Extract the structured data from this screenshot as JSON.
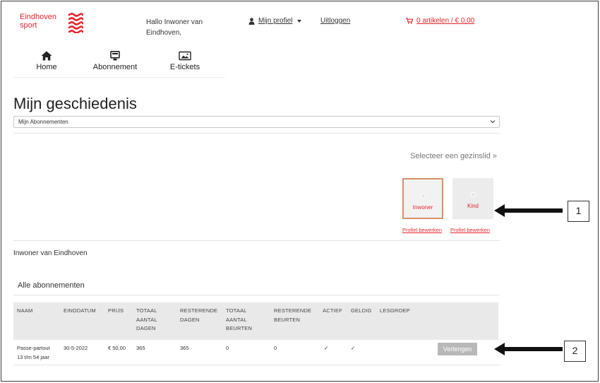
{
  "header": {
    "logo_line1": "Eindhoven",
    "logo_line2": "sport",
    "greeting_line1": "Hallo Inwoner van",
    "greeting_line2": "Eindhoven,",
    "profile_label": "Mijn profiel",
    "logout_label": "Uitloggen",
    "cart_label": "0 artikelen / € 0,00",
    "brand_color": "#e5262e"
  },
  "nav": [
    {
      "label": "Home",
      "icon": "home-icon"
    },
    {
      "label": "Abonnement",
      "icon": "monitor-icon"
    },
    {
      "label": "E-tickets",
      "icon": "image-icon"
    }
  ],
  "page": {
    "title": "Mijn geschiedenis",
    "select_value": "Mijn Abonnementen",
    "select_member_link": "Selecteer een gezinslid »",
    "members": [
      {
        "name": "Inwoner",
        "edit": "Profiel bewerken",
        "active": true
      },
      {
        "name": "Kind",
        "edit": "Profiel bewerken",
        "active": false
      }
    ],
    "member_name": "Inwoner van Eindhoven",
    "section_title": "Alle abonnementen"
  },
  "table": {
    "headers": [
      "NAAM",
      "EINDDATUM",
      "PRIJS",
      "TOTAAL\nAANTAL\nDAGEN",
      "RESTERENDE\nDAGEN",
      "TOTAAL\nAANTAL\nBEURTEN",
      "RESTERENDE\nBEURTEN",
      "ACTIEF",
      "GELDIG",
      "LESGROEP"
    ],
    "rows": [
      {
        "name": "Passe-partout\n13 t/m 54 jaar",
        "end_date": "30-5-2022",
        "price": "€ 50,00",
        "total_days": "365",
        "remaining_days": "365",
        "total_visits": "0",
        "remaining_visits": "0",
        "active": "✓",
        "valid": "✓",
        "lesson_group": "",
        "action_label": "Verlengen"
      }
    ]
  },
  "callouts": {
    "one": "1",
    "two": "2"
  }
}
